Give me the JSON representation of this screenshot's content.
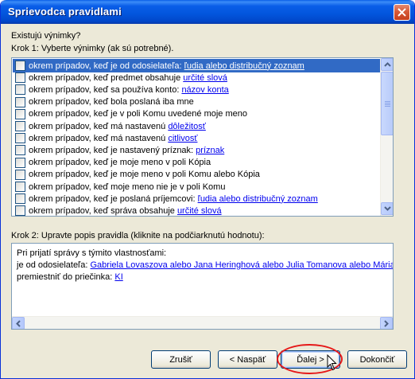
{
  "window": {
    "title": "Sprievodca pravidlami"
  },
  "step1": {
    "heading": "Existujú výnimky?",
    "label": "Krok 1: Vyberte výnimky (ak sú potrebné).",
    "items": [
      {
        "text": "okrem prípadov, keď je od odosielateľa: ",
        "link": "ľudia alebo distribučný zoznam",
        "checked": false,
        "selected": true
      },
      {
        "text": "okrem prípadov, keď predmet obsahuje ",
        "link": "určité slová",
        "checked": false,
        "selected": false
      },
      {
        "text": "okrem prípadov, keď sa používa konto: ",
        "link": "názov konta",
        "checked": false,
        "selected": false
      },
      {
        "text": "okrem prípadov, keď bola poslaná iba mne",
        "link": "",
        "checked": false,
        "selected": false
      },
      {
        "text": "okrem prípadov, keď je v poli Komu uvedené moje meno",
        "link": "",
        "checked": false,
        "selected": false
      },
      {
        "text": "okrem prípadov, keď má nastavenú ",
        "link": "dôležitosť",
        "checked": false,
        "selected": false
      },
      {
        "text": "okrem prípadov, keď má nastavenú ",
        "link": "citlivosť",
        "checked": false,
        "selected": false
      },
      {
        "text": "okrem prípadov, keď je nastavený príznak: ",
        "link": "príznak",
        "checked": false,
        "selected": false
      },
      {
        "text": "okrem prípadov, keď je moje meno v poli Kópia",
        "link": "",
        "checked": false,
        "selected": false
      },
      {
        "text": "okrem prípadov, keď je moje meno v poli Komu alebo Kópia",
        "link": "",
        "checked": false,
        "selected": false
      },
      {
        "text": "okrem prípadov, keď moje meno nie je v poli Komu",
        "link": "",
        "checked": false,
        "selected": false
      },
      {
        "text": "okrem prípadov, keď je poslaná príjemcovi: ",
        "link": "ľudia alebo distribučný zoznam",
        "checked": false,
        "selected": false
      },
      {
        "text": "okrem prípadov, keď správa obsahuje ",
        "link": "určité slová",
        "checked": false,
        "selected": false
      }
    ]
  },
  "step2": {
    "label": "Krok 2: Upravte popis pravidla (kliknite na podčiarknutú hodnotu):",
    "line1": "Pri prijatí správy s týmito vlastnosťami:",
    "line2_text": "je od odosielateľa: ",
    "line2_link": "Gabriela Lovaszova alebo Jana Heringhová alebo Julia Tomanova alebo Mária Be",
    "line3_text": "premiestniť do priečinka: ",
    "line3_link": "KI"
  },
  "buttons": {
    "cancel": "Zrušiť",
    "back": "< Naspäť",
    "next": "Ďalej >",
    "finish": "Dokončiť"
  },
  "colors": {
    "titlebar": "#0255dc",
    "selection": "#316ac5",
    "link": "#0000ee",
    "highlight_oval": "#e51818"
  }
}
